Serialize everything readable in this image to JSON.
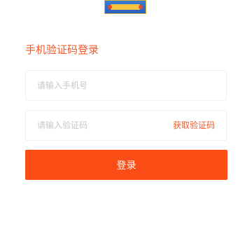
{
  "header": {
    "logo_icon": "banner-logo"
  },
  "title": "手机验证码登录",
  "phone_field": {
    "placeholder": "请输入手机号",
    "value": ""
  },
  "code_field": {
    "placeholder": "请输入验证码",
    "value": "",
    "get_code_label": "获取验证码"
  },
  "login_button": {
    "label": "登录"
  },
  "colors": {
    "accent": "#f05a2a",
    "button": "#fb4e16",
    "border": "#f0f0f0",
    "placeholder": "#c7c7c7"
  }
}
